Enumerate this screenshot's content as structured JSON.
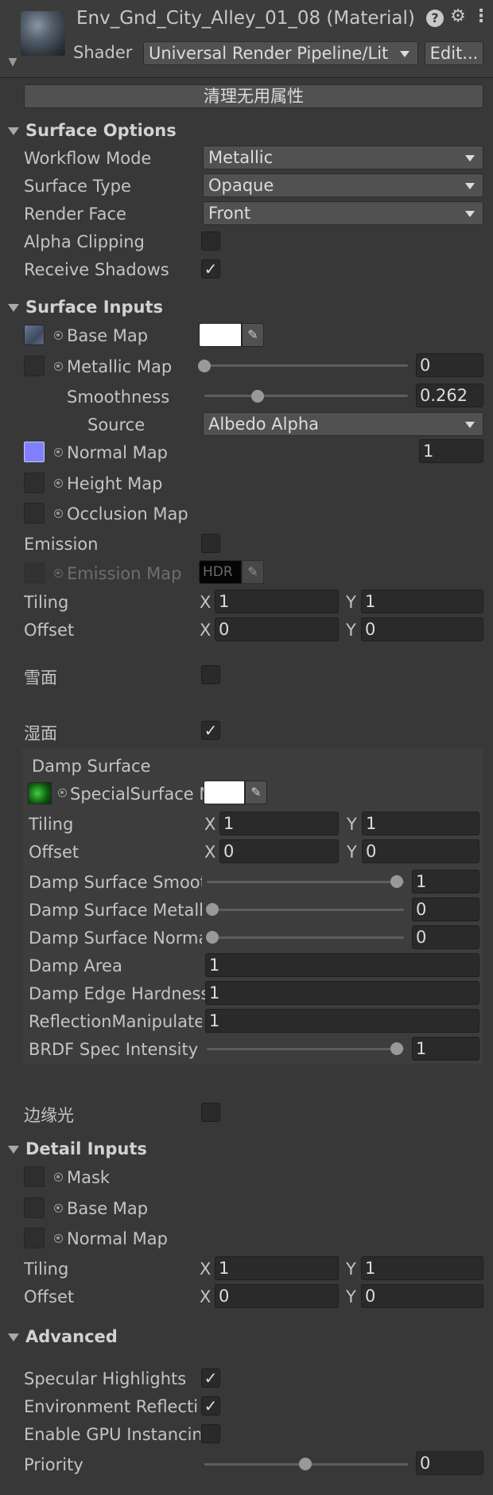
{
  "header": {
    "title": "Env_Gnd_City_Alley_01_08 (Material)",
    "shader_label": "Shader",
    "shader_value": "Universal Render Pipeline/Lit",
    "edit_label": "Edit...",
    "help_icon": "help-icon",
    "settings_icon": "sliders-icon",
    "menu_icon": "kebab-menu-icon"
  },
  "cleanup_button": "清理无用属性",
  "surface_options": {
    "title": "Surface Options",
    "workflow_label": "Workflow Mode",
    "workflow_value": "Metallic",
    "surface_type_label": "Surface Type",
    "surface_type_value": "Opaque",
    "render_face_label": "Render Face",
    "render_face_value": "Front",
    "alpha_clipping_label": "Alpha Clipping",
    "alpha_clipping_checked": false,
    "receive_shadows_label": "Receive Shadows",
    "receive_shadows_checked": true
  },
  "surface_inputs": {
    "title": "Surface Inputs",
    "base_map_label": "Base Map",
    "metallic_map_label": "Metallic Map",
    "metallic_value": "0",
    "metallic_fraction": 0,
    "smoothness_label": "Smoothness",
    "smoothness_value": "0.262",
    "smoothness_fraction": 0.262,
    "source_label": "Source",
    "source_value": "Albedo Alpha",
    "normal_map_label": "Normal Map",
    "normal_value": "1",
    "height_map_label": "Height Map",
    "occlusion_map_label": "Occlusion Map",
    "emission_label": "Emission",
    "emission_checked": false,
    "emission_map_label": "Emission Map",
    "hdr_label": "HDR",
    "tiling_label": "Tiling",
    "offset_label": "Offset",
    "tiling_x": "1",
    "tiling_y": "1",
    "offset_x": "0",
    "offset_y": "0",
    "x_label": "X",
    "y_label": "Y"
  },
  "snow": {
    "label": "雪面",
    "checked": false
  },
  "wet": {
    "label": "湿面",
    "checked": true
  },
  "damp_surface": {
    "title": "Damp Surface",
    "special_surface_label": "SpecialSurface M",
    "tiling_label": "Tiling",
    "offset_label": "Offset",
    "tiling_x": "1",
    "tiling_y": "1",
    "offset_x": "0",
    "offset_y": "0",
    "smooth_label": "Damp Surface Smooth",
    "smooth_value": "1",
    "smooth_fraction": 1,
    "metallic_label": "Damp Surface Metallic",
    "metallic_value": "0",
    "metallic_fraction": 0,
    "normal_label": "Damp Surface Normal",
    "normal_value": "0",
    "normal_fraction": 0,
    "area_label": "Damp Area",
    "area_value": "1",
    "edge_label": "Damp Edge Hardness",
    "edge_value": "1",
    "reflection_label": "ReflectionManipulate W",
    "reflection_value": "1",
    "brdf_label": "BRDF Spec Intensity",
    "brdf_value": "1",
    "brdf_fraction": 1
  },
  "rim": {
    "label": "边缘光",
    "checked": false
  },
  "detail_inputs": {
    "title": "Detail Inputs",
    "mask_label": "Mask",
    "base_map_label": "Base Map",
    "normal_map_label": "Normal Map",
    "tiling_label": "Tiling",
    "offset_label": "Offset",
    "tiling_x": "1",
    "tiling_y": "1",
    "offset_x": "0",
    "offset_y": "0"
  },
  "advanced": {
    "title": "Advanced",
    "specular_label": "Specular Highlights",
    "specular_checked": true,
    "env_reflections_label": "Environment Reflections",
    "env_reflections_checked": true,
    "gpu_instancing_label": "Enable GPU Instancing",
    "gpu_instancing_checked": false,
    "priority_label": "Priority",
    "priority_value": "0",
    "priority_fraction": 0.5
  },
  "colors": {
    "background": "#383838",
    "field": "#2a2a2a",
    "button": "#515151",
    "normal_map_swatch": "#8080ff",
    "special_surface_thumb": "#1a8a1a"
  }
}
